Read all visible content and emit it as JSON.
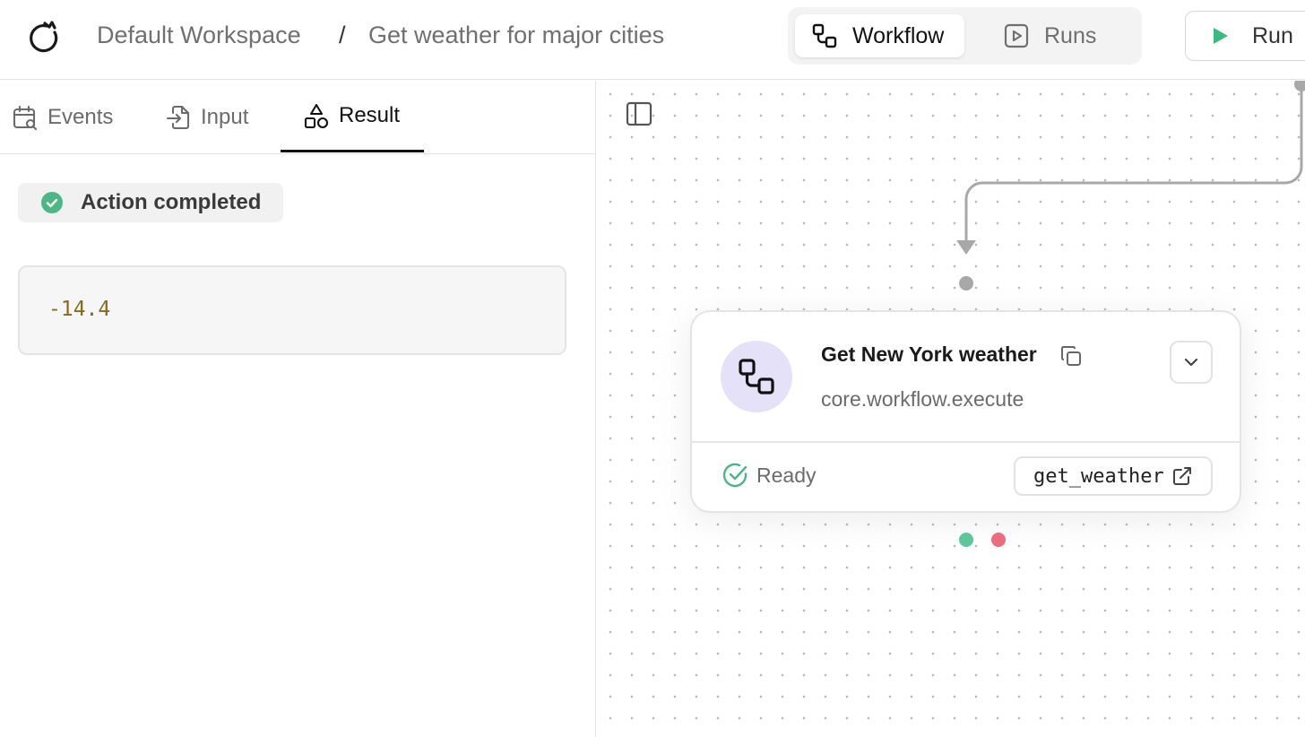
{
  "header": {
    "workspace": "Default Workspace",
    "separator": "/",
    "workflow_title": "Get weather for major cities",
    "view_tabs": [
      {
        "label": "Workflow",
        "active": true
      },
      {
        "label": "Runs",
        "active": false
      }
    ],
    "run_label": "Run"
  },
  "left_panel": {
    "tabs": [
      {
        "label": "Events",
        "icon": "calendar-search-icon",
        "active": false
      },
      {
        "label": "Input",
        "icon": "file-input-icon",
        "active": false
      },
      {
        "label": "Result",
        "icon": "shapes-icon",
        "active": true
      }
    ],
    "status": "Action completed",
    "result_value": "-14.4"
  },
  "canvas": {
    "node": {
      "title": "Get New York weather",
      "action_type": "core.workflow.execute",
      "status": "Ready",
      "reference": "get_weather",
      "icon": "workflow-icon"
    }
  },
  "colors": {
    "success": "#5cc79a",
    "error": "#ec6b7e",
    "run_accent": "#3fba7f",
    "node_icon_bg": "#e4e1f8",
    "result_text": "#8a6a1a"
  }
}
